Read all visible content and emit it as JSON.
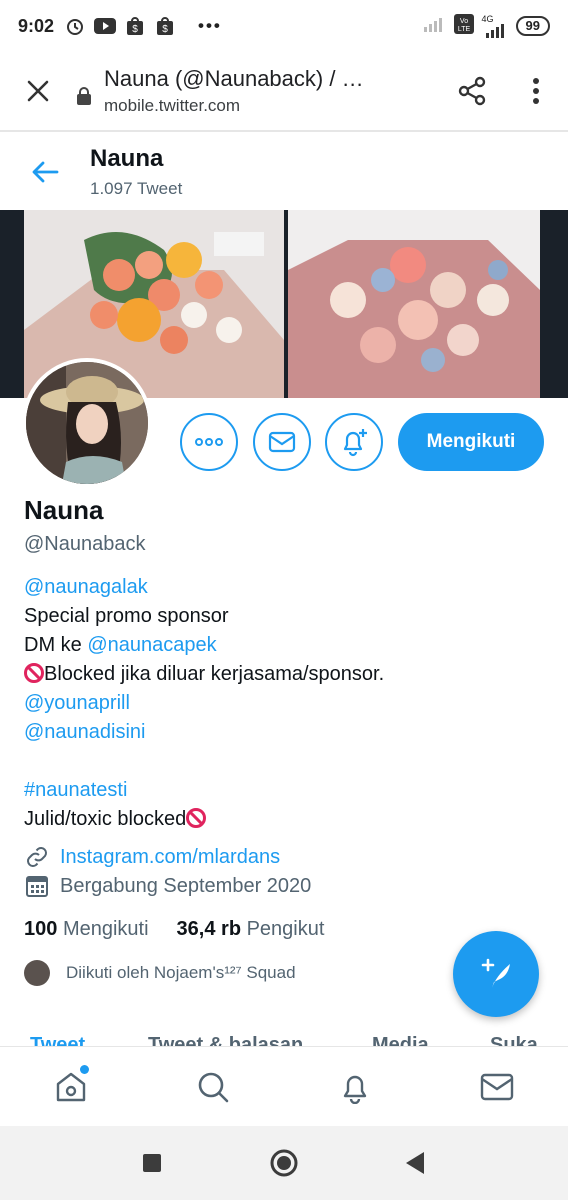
{
  "status_bar": {
    "time": "9:02",
    "dots": "•••",
    "network": "4G",
    "battery": "99"
  },
  "browser": {
    "title": "Nauna (@Naunaback) / …",
    "url": "mobile.twitter.com"
  },
  "profile_header": {
    "name": "Nauna",
    "tweet_count": "1.097 Tweet"
  },
  "profile": {
    "name": "Nauna",
    "handle": "@Naunaback",
    "follow_button": "Mengikuti",
    "bio": {
      "line1": "@naunagalak",
      "line2": "Special promo sponsor",
      "line3_prefix": "DM ke ",
      "line3_link": "@naunacapek",
      "line4": "Blocked jika diluar kerjasama/sponsor.",
      "line5": "@younaprill",
      "line6": "@naunadisini",
      "line7": "#naunatesti",
      "line8": "Julid/toxic blocked"
    },
    "website": "Instagram.com/mlardans",
    "joined": "Bergabung September 2020",
    "following_count": "100",
    "following_label": "Mengikuti",
    "followers_count": "36,4 rb",
    "followers_label": "Pengikut",
    "followed_by": "Diikuti oleh Nojaem's¹²⁷ Squad"
  },
  "tabs": [
    "Tweet",
    "Tweet & balasan",
    "Media",
    "Suka"
  ],
  "icons": {
    "accent": "#1d9bf0",
    "ban_color": "#e0245e"
  }
}
